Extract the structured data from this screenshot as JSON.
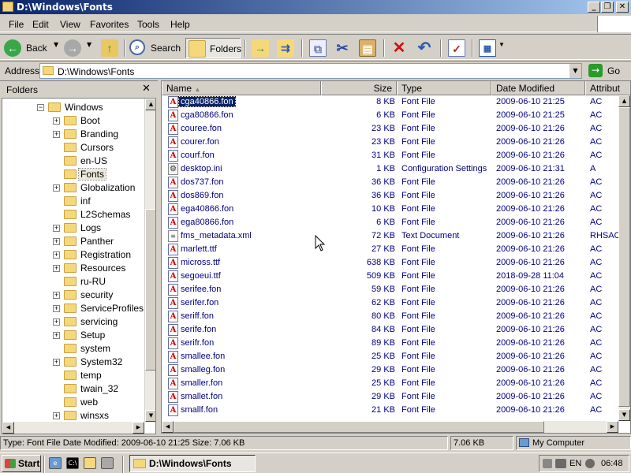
{
  "window": {
    "title": "D:\\Windows\\Fonts",
    "min": "_",
    "restore": "❐",
    "close": "✕"
  },
  "menu": [
    "File",
    "Edit",
    "View",
    "Favorites",
    "Tools",
    "Help"
  ],
  "toolbar": {
    "back": "Back",
    "search": "Search",
    "folders": "Folders"
  },
  "address": {
    "label": "Address",
    "value": "D:\\Windows\\Fonts",
    "go": "Go"
  },
  "folders_pane": {
    "title": "Folders",
    "items": [
      {
        "label": "Windows",
        "expander": "−",
        "level": 0
      },
      {
        "label": "Boot",
        "expander": "+",
        "level": 1
      },
      {
        "label": "Branding",
        "expander": "+",
        "level": 1
      },
      {
        "label": "Cursors",
        "expander": "",
        "level": 1
      },
      {
        "label": "en-US",
        "expander": "",
        "level": 1
      },
      {
        "label": "Fonts",
        "expander": "",
        "level": 1,
        "selected": true
      },
      {
        "label": "Globalization",
        "expander": "+",
        "level": 1
      },
      {
        "label": "inf",
        "expander": "",
        "level": 1
      },
      {
        "label": "L2Schemas",
        "expander": "",
        "level": 1
      },
      {
        "label": "Logs",
        "expander": "+",
        "level": 1
      },
      {
        "label": "Panther",
        "expander": "+",
        "level": 1
      },
      {
        "label": "Registration",
        "expander": "+",
        "level": 1
      },
      {
        "label": "Resources",
        "expander": "+",
        "level": 1
      },
      {
        "label": "ru-RU",
        "expander": "",
        "level": 1
      },
      {
        "label": "security",
        "expander": "+",
        "level": 1
      },
      {
        "label": "ServiceProfiles",
        "expander": "+",
        "level": 1
      },
      {
        "label": "servicing",
        "expander": "+",
        "level": 1
      },
      {
        "label": "Setup",
        "expander": "+",
        "level": 1
      },
      {
        "label": "system",
        "expander": "",
        "level": 1
      },
      {
        "label": "System32",
        "expander": "+",
        "level": 1
      },
      {
        "label": "temp",
        "expander": "",
        "level": 1
      },
      {
        "label": "twain_32",
        "expander": "",
        "level": 1
      },
      {
        "label": "web",
        "expander": "",
        "level": 1
      },
      {
        "label": "winsxs",
        "expander": "+",
        "level": 1
      }
    ]
  },
  "files": {
    "columns": {
      "name": "Name",
      "size": "Size",
      "type": "Type",
      "date": "Date Modified",
      "attr": "Attribut"
    },
    "rows": [
      {
        "name": "cga40866.fon",
        "size": "8 KB",
        "type": "Font File",
        "date": "2009-06-10 21:25",
        "attr": "AC",
        "kind": "font",
        "selected": true
      },
      {
        "name": "cga80866.fon",
        "size": "6 KB",
        "type": "Font File",
        "date": "2009-06-10 21:25",
        "attr": "AC",
        "kind": "font"
      },
      {
        "name": "couree.fon",
        "size": "23 KB",
        "type": "Font File",
        "date": "2009-06-10 21:26",
        "attr": "AC",
        "kind": "font"
      },
      {
        "name": "courer.fon",
        "size": "23 KB",
        "type": "Font File",
        "date": "2009-06-10 21:26",
        "attr": "AC",
        "kind": "font"
      },
      {
        "name": "courf.fon",
        "size": "31 KB",
        "type": "Font File",
        "date": "2009-06-10 21:26",
        "attr": "AC",
        "kind": "font"
      },
      {
        "name": "desktop.ini",
        "size": "1 KB",
        "type": "Configuration Settings",
        "date": "2009-06-10 21:31",
        "attr": "A",
        "kind": "ini"
      },
      {
        "name": "dos737.fon",
        "size": "36 KB",
        "type": "Font File",
        "date": "2009-06-10 21:26",
        "attr": "AC",
        "kind": "font"
      },
      {
        "name": "dos869.fon",
        "size": "36 KB",
        "type": "Font File",
        "date": "2009-06-10 21:26",
        "attr": "AC",
        "kind": "font"
      },
      {
        "name": "ega40866.fon",
        "size": "10 KB",
        "type": "Font File",
        "date": "2009-06-10 21:26",
        "attr": "AC",
        "kind": "font"
      },
      {
        "name": "ega80866.fon",
        "size": "6 KB",
        "type": "Font File",
        "date": "2009-06-10 21:26",
        "attr": "AC",
        "kind": "font"
      },
      {
        "name": "fms_metadata.xml",
        "size": "72 KB",
        "type": "Text Document",
        "date": "2009-06-10 21:26",
        "attr": "RHSAC",
        "kind": "txt"
      },
      {
        "name": "marlett.ttf",
        "size": "27 KB",
        "type": "Font File",
        "date": "2009-06-10 21:26",
        "attr": "AC",
        "kind": "font"
      },
      {
        "name": "micross.ttf",
        "size": "638 KB",
        "type": "Font File",
        "date": "2009-06-10 21:26",
        "attr": "AC",
        "kind": "font"
      },
      {
        "name": "segoeui.ttf",
        "size": "509 KB",
        "type": "Font File",
        "date": "2018-09-28 11:04",
        "attr": "AC",
        "kind": "font"
      },
      {
        "name": "serifee.fon",
        "size": "59 KB",
        "type": "Font File",
        "date": "2009-06-10 21:26",
        "attr": "AC",
        "kind": "font"
      },
      {
        "name": "serifer.fon",
        "size": "62 KB",
        "type": "Font File",
        "date": "2009-06-10 21:26",
        "attr": "AC",
        "kind": "font"
      },
      {
        "name": "seriff.fon",
        "size": "80 KB",
        "type": "Font File",
        "date": "2009-06-10 21:26",
        "attr": "AC",
        "kind": "font"
      },
      {
        "name": "serife.fon",
        "size": "84 KB",
        "type": "Font File",
        "date": "2009-06-10 21:26",
        "attr": "AC",
        "kind": "font"
      },
      {
        "name": "serifr.fon",
        "size": "89 KB",
        "type": "Font File",
        "date": "2009-06-10 21:26",
        "attr": "AC",
        "kind": "font"
      },
      {
        "name": "smallee.fon",
        "size": "25 KB",
        "type": "Font File",
        "date": "2009-06-10 21:26",
        "attr": "AC",
        "kind": "font"
      },
      {
        "name": "smalleg.fon",
        "size": "29 KB",
        "type": "Font File",
        "date": "2009-06-10 21:26",
        "attr": "AC",
        "kind": "font"
      },
      {
        "name": "smaller.fon",
        "size": "25 KB",
        "type": "Font File",
        "date": "2009-06-10 21:26",
        "attr": "AC",
        "kind": "font"
      },
      {
        "name": "smallet.fon",
        "size": "29 KB",
        "type": "Font File",
        "date": "2009-06-10 21:26",
        "attr": "AC",
        "kind": "font"
      },
      {
        "name": "smallf.fon",
        "size": "21 KB",
        "type": "Font File",
        "date": "2009-06-10 21:26",
        "attr": "AC",
        "kind": "font"
      }
    ]
  },
  "status": {
    "info": "Type: Font File Date Modified: 2009-06-10 21:25 Size: 7.06 KB",
    "size": "7.06 KB",
    "zone": "My Computer"
  },
  "taskbar": {
    "start": "Start",
    "task": "D:\\Windows\\Fonts",
    "lang": "EN",
    "time": "06:48"
  },
  "colors": {
    "title_start": "#0a246a",
    "title_end": "#a6caf0",
    "chrome": "#d4d0c8",
    "file_text": "#000080",
    "selection": "#0a246a"
  }
}
